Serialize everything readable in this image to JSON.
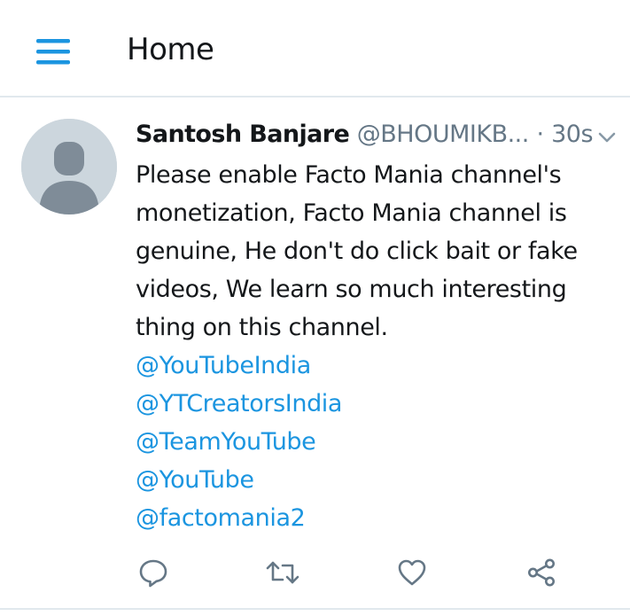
{
  "header": {
    "title": "Home",
    "menu_icon": "hamburger-menu-icon"
  },
  "tweet": {
    "author_name": "Santosh Banjare",
    "handle": "@BHOUMIKB...",
    "separator": "·",
    "time": "30s",
    "body_lines": [
      "Please enable Facto Mania  channel's",
      "monetization, Facto Mania channel is",
      "genuine, He don't do click bait or fake",
      "videos, We learn so much interesting",
      "thing on this  channel."
    ],
    "mentions": [
      "@YouTubeIndia",
      "@YTCreatorsIndia",
      "@TeamYouTube",
      "@YouTube",
      "@factomania2"
    ],
    "actions": [
      {
        "name": "reply",
        "icon": "reply-icon"
      },
      {
        "name": "retweet",
        "icon": "retweet-icon"
      },
      {
        "name": "like",
        "icon": "heart-icon"
      },
      {
        "name": "share",
        "icon": "share-icon"
      }
    ]
  },
  "colors": {
    "accent": "#1b95e0",
    "muted": "#657786",
    "icon": "#657786",
    "avatar_bg": "#ccd6dd",
    "avatar_fg": "#7f8c98",
    "divider": "#e1e8ed"
  }
}
